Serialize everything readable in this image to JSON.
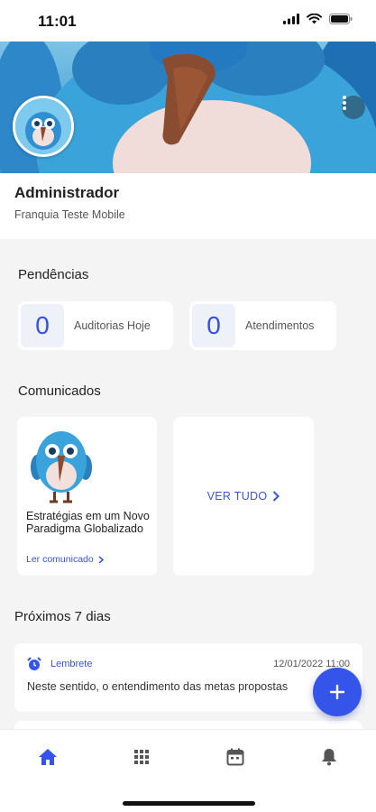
{
  "status_bar": {
    "time": "11:01"
  },
  "profile": {
    "name": "Administrador",
    "subtitle": "Franquia Teste Mobile"
  },
  "pendencias": {
    "title": "Pendências",
    "cards": [
      {
        "count": "0",
        "label": "Auditorias Hoje"
      },
      {
        "count": "0",
        "label": "Atendimentos"
      }
    ]
  },
  "comunicados": {
    "title": "Comunicados",
    "item": {
      "title": "Estratégias em um Novo Paradigma Globalizado",
      "link": "Ler comunicado"
    },
    "see_all": "VER TUDO"
  },
  "agenda": {
    "title": "Próximos 7 dias",
    "items": [
      {
        "type": "Lembrete",
        "date": "12/01/2022 11:00",
        "text": "Neste sentido, o entendimento das metas propostas"
      }
    ]
  },
  "colors": {
    "accent": "#3454ea",
    "link": "#3a55d8",
    "background": "#f4f4f5"
  },
  "icons": {
    "nav": [
      "home-icon",
      "grid-icon",
      "calendar-icon",
      "bell-icon"
    ],
    "fab": "plus-icon"
  }
}
